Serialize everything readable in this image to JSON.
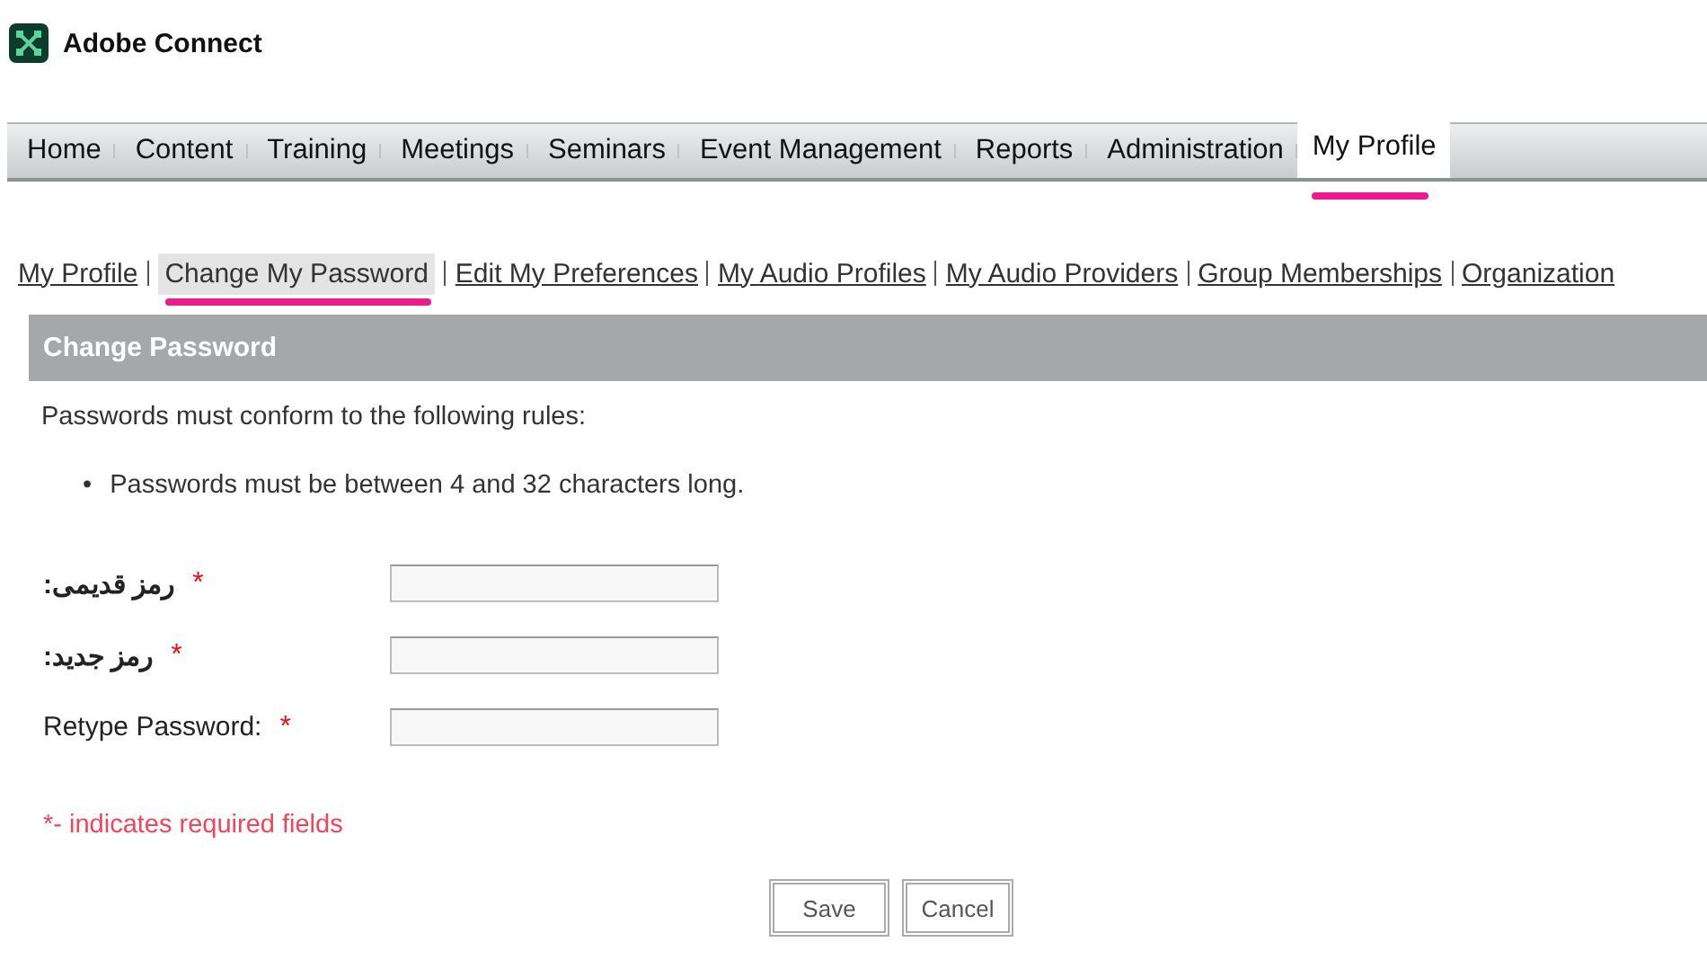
{
  "app": {
    "title": "Adobe Connect"
  },
  "nav": [
    {
      "label": "Home",
      "selected": false
    },
    {
      "label": "Content",
      "selected": false
    },
    {
      "label": "Training",
      "selected": false
    },
    {
      "label": "Meetings",
      "selected": false
    },
    {
      "label": "Seminars",
      "selected": false
    },
    {
      "label": "Event Management",
      "selected": false
    },
    {
      "label": "Reports",
      "selected": false
    },
    {
      "label": "Administration",
      "selected": false
    },
    {
      "label": "My Profile",
      "selected": true
    }
  ],
  "subnav": [
    {
      "label": "My Profile",
      "selected": false
    },
    {
      "label": "Change My Password",
      "selected": true
    },
    {
      "label": "Edit My Preferences",
      "selected": false
    },
    {
      "label": "My Audio Profiles",
      "selected": false
    },
    {
      "label": "My Audio Providers",
      "selected": false
    },
    {
      "label": "Group Memberships",
      "selected": false
    },
    {
      "label": "Organization",
      "selected": false
    }
  ],
  "panel": {
    "title": "Change Password",
    "intro": "Passwords must conform to the following rules:",
    "rules": [
      {
        "bullet": "•",
        "text": "Passwords must be between 4 and 32 characters long."
      }
    ],
    "fields": [
      {
        "label": "رمز قدیمی:",
        "marker": "*"
      },
      {
        "label": "رمز جدید:",
        "marker": "*"
      },
      {
        "label": "Retype Password:",
        "marker": "*"
      }
    ],
    "note": "*- indicates required fields",
    "buttons": [
      "Save",
      "Cancel"
    ]
  }
}
